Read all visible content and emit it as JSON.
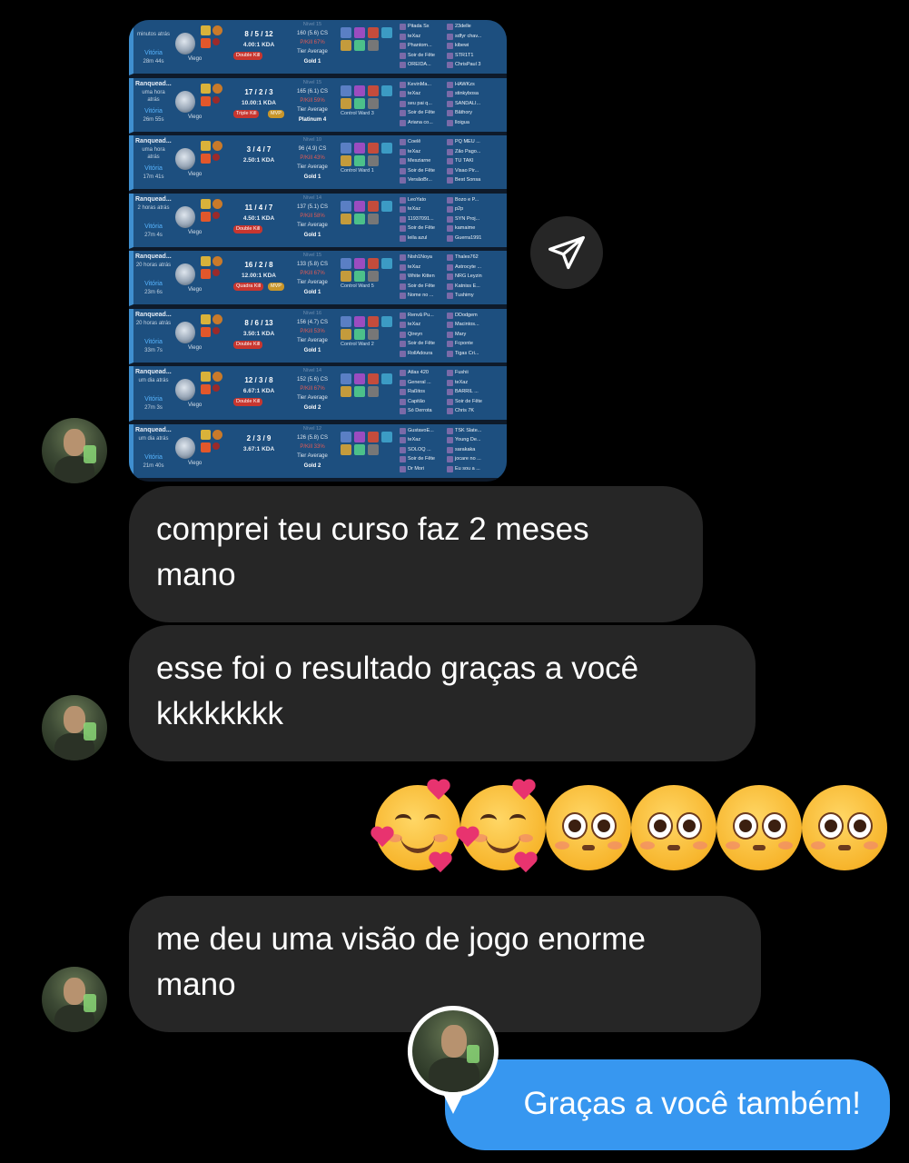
{
  "history": {
    "rows": [
      {
        "queue": "",
        "ago": "minutos atrás",
        "result": "Vitória",
        "duration": "28m 44s",
        "champion": "Viego",
        "kda": "8 / 5 / 12",
        "ratio": "4.00:1 KDA",
        "badges": [
          "Double Kill"
        ],
        "level": "Nível 15",
        "cs": "160 (5.6) CS",
        "pkill": "P/Kill 67%",
        "tier": "Tier Average",
        "rank": "Gold 1",
        "ward": "",
        "team_a": [
          "Pitada Sx",
          "teXaz",
          "Phantom...",
          "Soir de Fête",
          "OREIDA..."
        ],
        "team_b": [
          "23delle",
          "sdfyr chav...",
          "kibewi",
          "STR1T1",
          "ChrisPaul 3"
        ]
      },
      {
        "queue": "Ranquead...",
        "ago": "uma hora atrás",
        "result": "Vitória",
        "duration": "26m 55s",
        "champion": "Viego",
        "kda": "17 / 2 / 3",
        "ratio": "10.00:1 KDA",
        "badges": [
          "Triple Kill",
          "MVP"
        ],
        "level": "Nível 15",
        "cs": "165 (6.1) CS",
        "pkill": "P/Kill 59%",
        "tier": "Tier Average",
        "rank": "Platinum 4",
        "ward": "Control Ward 3",
        "team_a": [
          "KevinMa...",
          "teXaz",
          "seu pai q...",
          "Soir de Fête",
          "Ariana co..."
        ],
        "team_b": [
          "HAWKzs",
          "stinkybosa",
          "SANDALI...",
          "Bâthory",
          "lloigua"
        ]
      },
      {
        "queue": "Ranquead...",
        "ago": "uma hora atrás",
        "result": "Vitória",
        "duration": "17m 41s",
        "champion": "Viego",
        "kda": "3 / 4 / 7",
        "ratio": "2.50:1 KDA",
        "badges": [],
        "level": "Nível 10",
        "cs": "96 (4.9) CS",
        "pkill": "P/Kill 43%",
        "tier": "Tier Average",
        "rank": "Gold 1",
        "ward": "Control Ward 1",
        "team_a": [
          "Coelê",
          "teXaz",
          "Mesziarne",
          "Soir de Fête",
          "VersãoBr..."
        ],
        "team_b": [
          "PQ MEU ...",
          "Zão Pago...",
          "TU TAKI",
          "Visao Pir...",
          "Best Sonsa"
        ]
      },
      {
        "queue": "Ranquead...",
        "ago": "2 horas atrás",
        "result": "Vitória",
        "duration": "27m 4s",
        "champion": "Viego",
        "kda": "11 / 4 / 7",
        "ratio": "4.50:1 KDA",
        "badges": [
          "Double Kill"
        ],
        "level": "Nível 14",
        "cs": "137 (5.1) CS",
        "pkill": "P/Kill 58%",
        "tier": "Tier Average",
        "rank": "Gold 1",
        "ward": "",
        "team_a": [
          "LeoYato",
          "teXaz",
          "11937091...",
          "Soir de Fête",
          "leila azul"
        ],
        "team_b": [
          "Bozo e P...",
          "p2p",
          "SYN Proj...",
          "kamaime",
          "Guerra1991"
        ]
      },
      {
        "queue": "Ranquead...",
        "ago": "20 horas atrás",
        "result": "Vitória",
        "duration": "23m 6s",
        "champion": "Viego",
        "kda": "16 / 2 / 8",
        "ratio": "12.00:1 KDA",
        "badges": [
          "Quadra Kill",
          "MVP"
        ],
        "level": "Nível 15",
        "cs": "133 (5.8) CS",
        "pkill": "P/Kill 67%",
        "tier": "Tier Average",
        "rank": "Gold 1",
        "ward": "Control Ward 5",
        "team_a": [
          "Nish1Noya",
          "teXaz",
          "White Kitten",
          "Soir de Fête",
          "Nome no ..."
        ],
        "team_b": [
          "Thales762",
          "Astrocyte ...",
          "NRG Leyzin",
          "Katniss E...",
          "Tushimy"
        ]
      },
      {
        "queue": "Ranquead...",
        "ago": "20 horas atrás",
        "result": "Vitória",
        "duration": "33m 7s",
        "champion": "Viego",
        "kda": "8 / 6 / 13",
        "ratio": "3.50:1 KDA",
        "badges": [
          "Double Kill"
        ],
        "level": "Nível 16",
        "cs": "156 (4.7) CS",
        "pkill": "P/Kill 53%",
        "tier": "Tier Average",
        "rank": "Gold 1",
        "ward": "Control Ward 2",
        "team_a": [
          "Renvã Pu...",
          "teXaz",
          "Qireyn",
          "Soir de Fête",
          "RollAdoura"
        ],
        "team_b": [
          "DDodgem",
          "Macintos...",
          "Mary",
          "Fcponte",
          "Tigas Cri..."
        ]
      },
      {
        "queue": "Ranquead...",
        "ago": "um dia atrás",
        "result": "Vitória",
        "duration": "27m 3s",
        "champion": "Viego",
        "kda": "12 / 3 / 8",
        "ratio": "6.67:1 KDA",
        "badges": [
          "Double Kill"
        ],
        "level": "Nível 14",
        "cs": "152 (5.6) CS",
        "pkill": "P/Kill 67%",
        "tier": "Tier Average",
        "rank": "Gold 2",
        "ward": "",
        "team_a": [
          "Atlas 420",
          "General ...",
          "Raßitos",
          "Capitão",
          "Só Derrota"
        ],
        "team_b": [
          "Fushii",
          "teXaz",
          "BARRIL ...",
          "Soir de Fête",
          "Chris 7K"
        ]
      },
      {
        "queue": "Ranquead...",
        "ago": "um dia atrás",
        "result": "Vitória",
        "duration": "21m 40s",
        "champion": "Viego",
        "kda": "2 / 3 / 9",
        "ratio": "3.67:1 KDA",
        "badges": [],
        "level": "Nível 12",
        "cs": "126 (5.8) CS",
        "pkill": "P/Kill 33%",
        "tier": "Tier Average",
        "rank": "Gold 2",
        "ward": "",
        "team_a": [
          "GustavoE...",
          "teXaz",
          "SOLOQ ...",
          "Soir de Fête",
          "Dr Mori"
        ],
        "team_b": [
          "TSK Slate...",
          "Young De...",
          "sarakaka",
          "jocare no ...",
          "Eu sou a ..."
        ]
      }
    ]
  },
  "messages": {
    "m1": {
      "line1": "comprei teu curso faz 2 meses",
      "line2": "mano"
    },
    "m2": {
      "line1": "esse foi o resultado graças a você",
      "line2": "kkkkkkkk"
    },
    "m3": {
      "line1": "me deu uma visão de jogo enorme",
      "line2": "mano"
    },
    "reply": "Graças a você também!"
  },
  "emoji_reactions": [
    "smiling-face-with-hearts",
    "smiling-face-with-hearts",
    "flushed-face",
    "flushed-face",
    "flushed-face",
    "flushed-face"
  ],
  "colors": {
    "background": "#000000",
    "incoming_bubble": "#262626",
    "outgoing_bubble": "#3797f0",
    "text": "#ffffff"
  }
}
